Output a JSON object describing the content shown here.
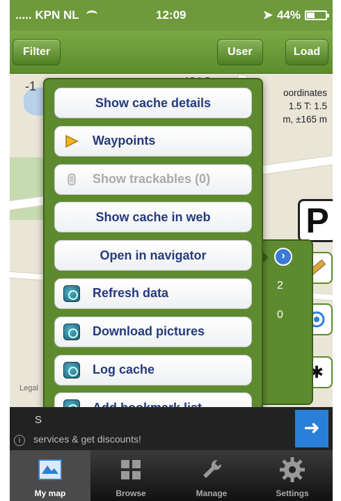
{
  "status_bar": {
    "carrier": "KPN NL",
    "time": "12:09",
    "battery": "44%",
    "battery_level": 0.44
  },
  "toolbar": {
    "filter_label": "Filter",
    "user_label": "User",
    "load_label": "Load"
  },
  "map": {
    "scale_tick": "-1",
    "partial_text": "°C ° C",
    "info_lines": [
      "oordinates",
      "1.5 T: 1.5",
      "m, ±165 m"
    ],
    "legal_label": "Legal"
  },
  "menu": {
    "items": [
      {
        "label": "Show cache details",
        "icon": "none"
      },
      {
        "label": "Waypoints",
        "icon": "flag-icon"
      },
      {
        "label": "Show trackables (0)",
        "icon": "trackable-icon",
        "disabled": true
      },
      {
        "label": "Show cache in web",
        "icon": "none"
      },
      {
        "label": "Open in navigator",
        "icon": "none"
      },
      {
        "label": "Refresh data",
        "icon": "app-icon"
      },
      {
        "label": "Download pictures",
        "icon": "app-icon"
      },
      {
        "label": "Log cache",
        "icon": "app-icon"
      },
      {
        "label": "Add bookmark list",
        "icon": "app-icon"
      }
    ]
  },
  "side_panel": {
    "value1": "2",
    "value2": "0"
  },
  "ad_banner": {
    "line1": "S",
    "line2": "services & get discounts!",
    "info_label": "i"
  },
  "tabs": [
    {
      "label": "My map",
      "active": true,
      "icon": "map-icon"
    },
    {
      "label": "Browse",
      "active": false,
      "icon": "grid-icon"
    },
    {
      "label": "Manage",
      "active": false,
      "icon": "wrench-icon"
    },
    {
      "label": "Settings",
      "active": false,
      "icon": "gear-icon"
    }
  ],
  "colors": {
    "toolbar_green": "#6f9a3c",
    "menu_text_blue": "#243a7c",
    "accent_blue": "#2a7fd8"
  }
}
